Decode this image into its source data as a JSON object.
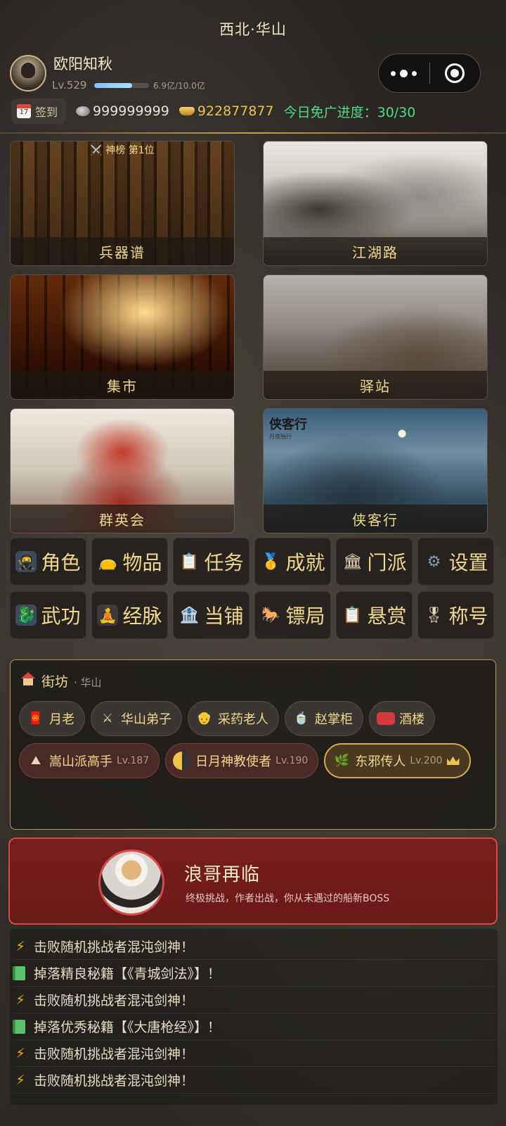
{
  "title": "西北·华山",
  "player": {
    "name": "欧阳知秋",
    "level": "Lv.529",
    "exp_text": "6.9亿/10.0亿",
    "exp_fraction": 0.69
  },
  "checkin_label": "签到",
  "resources": {
    "silver": "999999999",
    "gold": "922877877",
    "ad_progress": "今日免广进度：30/30"
  },
  "scenes": [
    {
      "label": "兵器谱",
      "badge": "⚔️ 神榜 第1位"
    },
    {
      "label": "江湖路"
    },
    {
      "label": "集市"
    },
    {
      "label": "驿站"
    },
    {
      "label": "群英会"
    },
    {
      "label": "侠客行",
      "stamp": "侠客行",
      "stamp_sub": "月夜独行"
    }
  ],
  "menu": [
    {
      "label": "角色",
      "icon": "character-icon"
    },
    {
      "label": "物品",
      "icon": "bag-icon"
    },
    {
      "label": "任务",
      "icon": "clipboard-icon"
    },
    {
      "label": "成就",
      "icon": "medal-icon"
    },
    {
      "label": "门派",
      "icon": "temple-icon"
    },
    {
      "label": "设置",
      "icon": "gear-icon"
    },
    {
      "label": "武功",
      "icon": "martial-arts-icon"
    },
    {
      "label": "经脉",
      "icon": "meridian-icon"
    },
    {
      "label": "当铺",
      "icon": "bank-icon"
    },
    {
      "label": "镖局",
      "icon": "horse-icon"
    },
    {
      "label": "悬赏",
      "icon": "clipboard-icon"
    },
    {
      "label": "称号",
      "icon": "medal-icon"
    }
  ],
  "street": {
    "title": "街坊",
    "subtitle": "· 华山",
    "npcs": [
      {
        "name": "月老",
        "icon": "red-envelope-icon",
        "style": "normal"
      },
      {
        "name": "华山弟子",
        "icon": "swords-icon",
        "style": "normal"
      },
      {
        "name": "采药老人",
        "icon": "old-man-icon",
        "style": "normal"
      },
      {
        "name": "赵掌柜",
        "icon": "bowl-icon",
        "style": "normal"
      },
      {
        "name": "酒楼",
        "icon": "wine-icon",
        "style": "normal"
      },
      {
        "name": "嵩山派高手",
        "level": "Lv.187",
        "icon": "mountain-icon",
        "style": "red"
      },
      {
        "name": "日月神教使者",
        "level": "Lv.190",
        "icon": "half-moon-icon",
        "style": "red"
      },
      {
        "name": "东邪传人",
        "level": "Lv.200",
        "icon": "herb-icon",
        "style": "gold"
      }
    ]
  },
  "boss": {
    "title": "浪哥再临",
    "subtitle": "终极挑战，作者出战，你从未遇过的船新BOSS"
  },
  "log": [
    {
      "icon": "bolt-icon",
      "text": "击败随机挑战者混沌剑神！"
    },
    {
      "icon": "book-icon",
      "text": "掉落精良秘籍【《青城剑法》】！"
    },
    {
      "icon": "bolt-icon",
      "text": "击败随机挑战者混沌剑神！"
    },
    {
      "icon": "book-icon",
      "text": "掉落优秀秘籍【《大唐枪经》】！"
    },
    {
      "icon": "bolt-icon",
      "text": "击败随机挑战者混沌剑神！"
    },
    {
      "icon": "bolt-icon",
      "text": "击败随机挑战者混沌剑神！"
    }
  ],
  "colors": {
    "accent_gold": "#f0d78a",
    "progress_green": "#4fdc86",
    "boss_red": "#7a1f1f"
  }
}
